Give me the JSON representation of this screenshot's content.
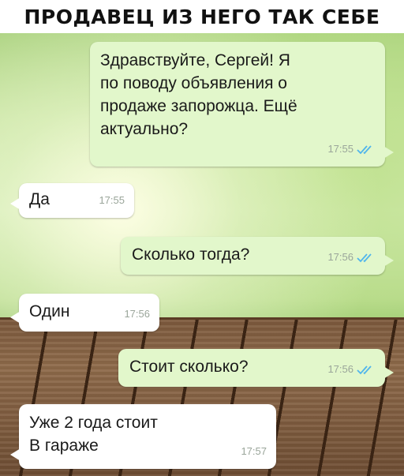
{
  "header": {
    "title": "ПРОДАВЕЦ ИЗ НЕГО ТАК СЕБЕ"
  },
  "chat": {
    "messages": [
      {
        "direction": "outgoing",
        "text": "Здравствуйте, Сергей! Я\nпо поводу объявления о\nпродаже запорожца. Ещё\nактуально?",
        "time": "17:55",
        "status": "read"
      },
      {
        "direction": "incoming",
        "text": "Да",
        "time": "17:55"
      },
      {
        "direction": "outgoing",
        "text": "Сколько тогда?",
        "time": "17:56",
        "status": "read"
      },
      {
        "direction": "incoming",
        "text": "Один",
        "time": "17:56"
      },
      {
        "direction": "outgoing",
        "text": "Стоит сколько?",
        "time": "17:56",
        "status": "read"
      },
      {
        "direction": "incoming",
        "text": "Уже 2 года стоит\nВ гараже",
        "time": "17:57"
      }
    ]
  },
  "colors": {
    "outgoing_bubble": "#e2f7cb",
    "incoming_bubble": "#ffffff",
    "read_ticks": "#4fb5ec",
    "timestamp": "#9aa59a"
  }
}
